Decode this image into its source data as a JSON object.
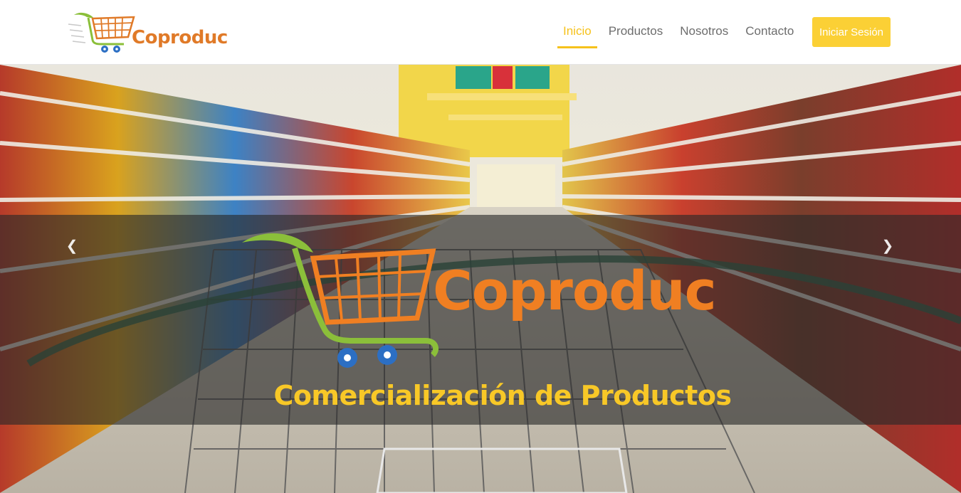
{
  "brand": {
    "name": "Coproduc"
  },
  "nav": {
    "items": [
      {
        "label": "Inicio",
        "active": true
      },
      {
        "label": "Productos",
        "active": false
      },
      {
        "label": "Nosotros",
        "active": false
      },
      {
        "label": "Contacto",
        "active": false
      }
    ],
    "login_label": "Iniciar Sesión"
  },
  "hero": {
    "brand_name": "Coproduc",
    "tagline": "Comercialización de Productos",
    "prev_icon": "chevron-left-icon",
    "next_icon": "chevron-right-icon"
  },
  "colors": {
    "accent": "#f6c21c",
    "button": "#fbd035",
    "brand_orange": "#e07a28",
    "cart_green": "#8bbf3a",
    "wheel_blue": "#2c6fc4"
  }
}
